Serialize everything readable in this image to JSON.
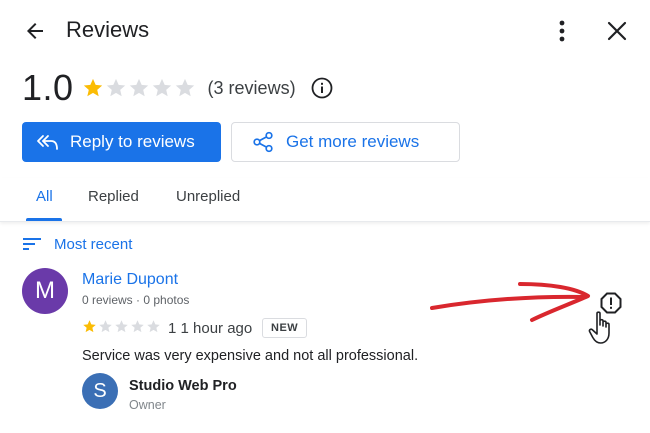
{
  "header": {
    "title": "Reviews",
    "back_icon": "arrow-left-icon",
    "more_icon": "more-vert-icon",
    "close_icon": "close-icon"
  },
  "summary": {
    "rating": "1.0",
    "stars_filled": 1,
    "stars_total": 5,
    "review_count": "(3 reviews)",
    "info_icon": "info-icon"
  },
  "actions": {
    "reply_label": "Reply to reviews",
    "get_more_label": "Get more reviews"
  },
  "tabs": [
    {
      "label": "All",
      "active": true
    },
    {
      "label": "Replied",
      "active": false
    },
    {
      "label": "Unreplied",
      "active": false
    }
  ],
  "sort": {
    "label": "Most recent",
    "icon": "sort-icon"
  },
  "review": {
    "avatar_letter": "M",
    "name": "Marie Dupont",
    "meta": "0 reviews · 0 photos",
    "stars_filled": 1,
    "stars_total": 5,
    "time": "1 1 hour ago",
    "badge": "NEW",
    "text": "Service was very expensive and not all professional.",
    "flag_icon": "report-flag-icon"
  },
  "owner": {
    "avatar_letter": "S",
    "name": "Studio Web Pro",
    "role": "Owner"
  },
  "colors": {
    "accent": "#1a73e8",
    "star_filled": "#fbbc04",
    "star_empty": "#dadce0",
    "avatar_reviewer": "#6a3aa9",
    "avatar_owner": "#3b6fb5",
    "annotation_arrow": "#d9272e"
  }
}
